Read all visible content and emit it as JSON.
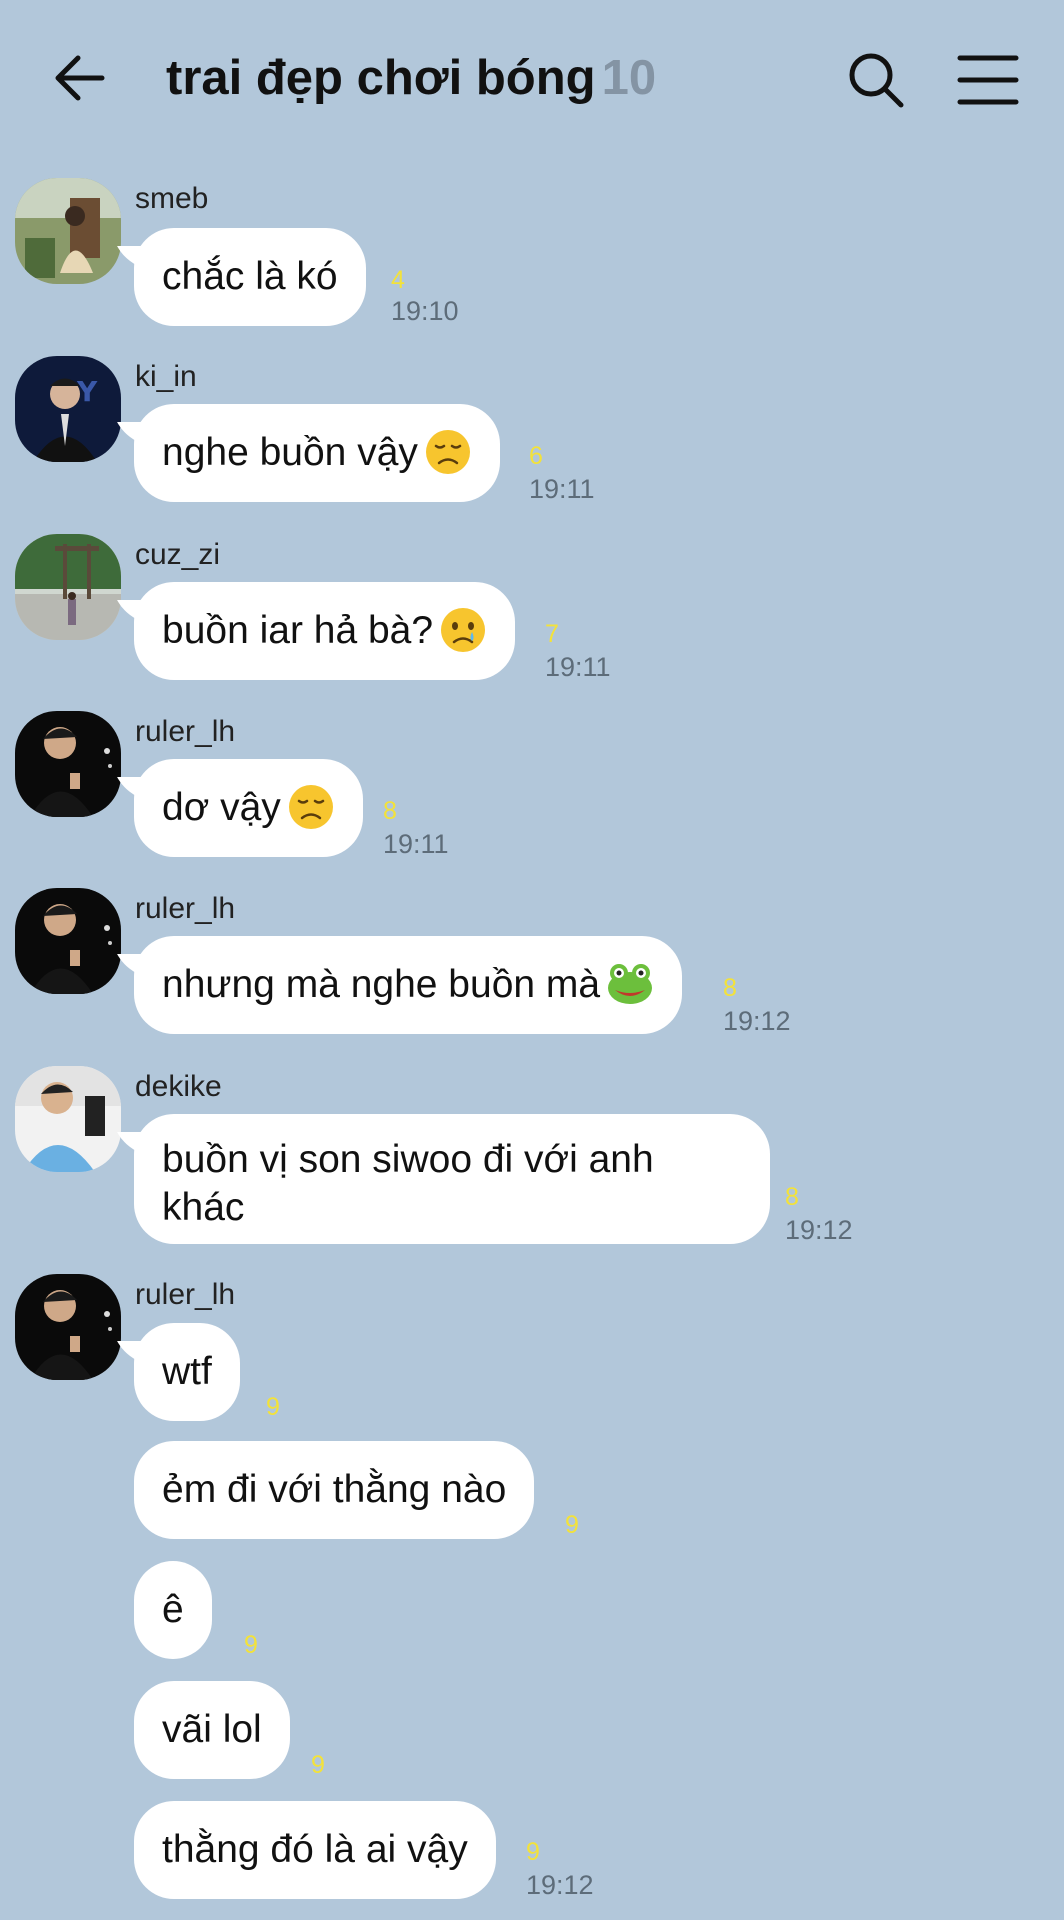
{
  "header": {
    "title": "trai đẹp chơi bóng",
    "member_count": "10",
    "back_icon": "arrow-left-icon",
    "search_icon": "search-icon",
    "menu_icon": "menu-icon"
  },
  "colors": {
    "background": "#b2c7da",
    "bubble": "#ffffff",
    "unread": "#f3e23a",
    "count": "#8494a4"
  },
  "messages": [
    {
      "sender": "smeb",
      "text": "chắc là kó",
      "unread": "4",
      "time": "19:10"
    },
    {
      "sender": "ki_in",
      "text": "nghe buồn vậy",
      "emoji": "disappointed-face",
      "unread": "6",
      "time": "19:11"
    },
    {
      "sender": "cuz_zi",
      "text": "buồn iar hả bà?",
      "emoji": "crying-face",
      "unread": "7",
      "time": "19:11"
    },
    {
      "sender": "ruler_lh",
      "text": "dơ vậy",
      "emoji": "disappointed-face",
      "unread": "8",
      "time": "19:11"
    },
    {
      "sender": "ruler_lh",
      "text": "nhưng mà nghe buồn mà",
      "emoji": "frog-face",
      "unread": "8",
      "time": "19:12"
    },
    {
      "sender": "dekike",
      "text": "buồn vị son siwoo đi với anh khác",
      "unread": "8",
      "time": "19:12"
    },
    {
      "sender": "ruler_lh",
      "text": "wtf",
      "unread": "9"
    },
    {
      "text": "ẻm đi với thằng nào",
      "unread": "9"
    },
    {
      "text": "ê",
      "unread": "9"
    },
    {
      "text": "vãi lol",
      "unread": "9"
    },
    {
      "text": "thằng đó là ai vậy",
      "unread": "9",
      "time": "19:12"
    }
  ]
}
